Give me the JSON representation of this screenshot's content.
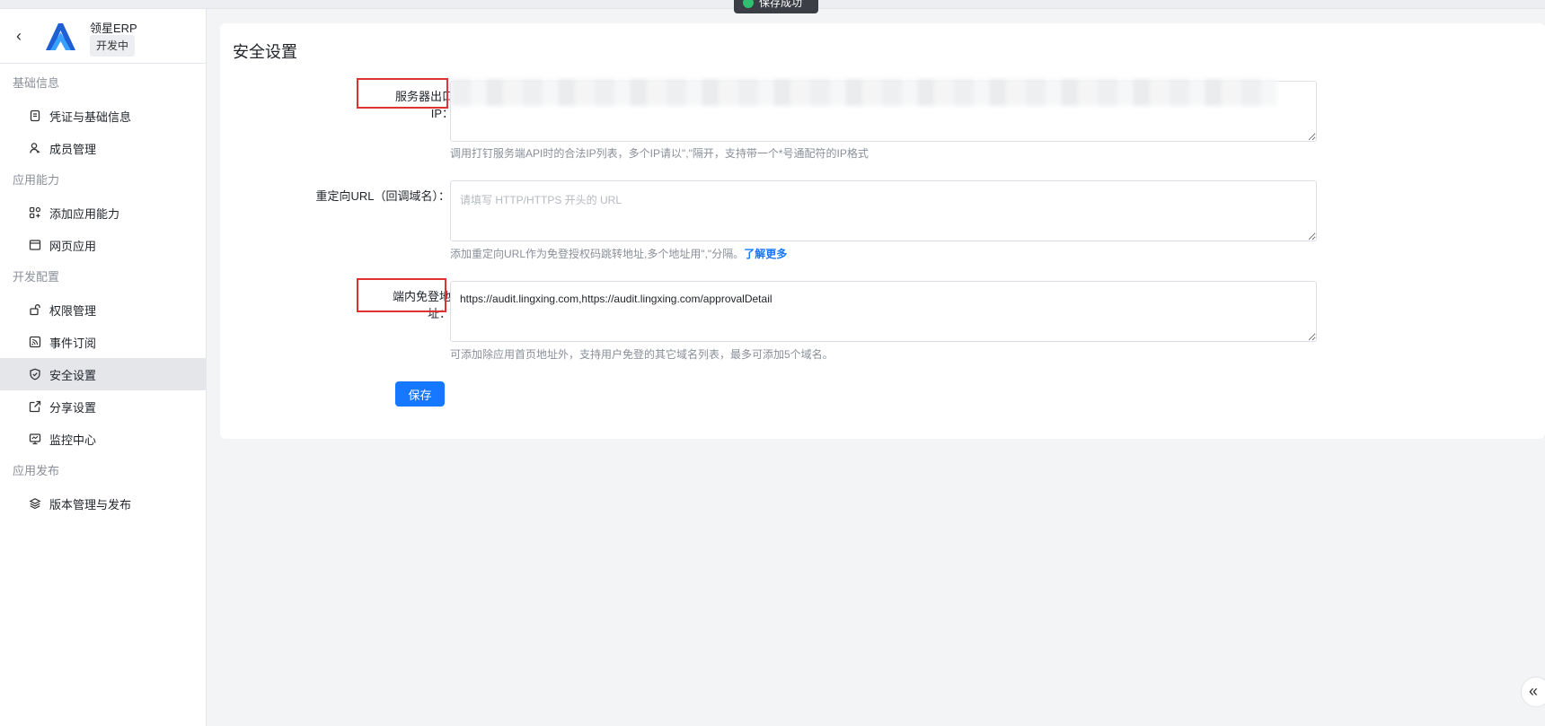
{
  "toast": {
    "text": "保存成功"
  },
  "app": {
    "name": "领星ERP",
    "status": "开发中"
  },
  "sidebar": {
    "groups": [
      {
        "title": "基础信息",
        "items": [
          {
            "label": "凭证与基础信息"
          },
          {
            "label": "成员管理"
          }
        ]
      },
      {
        "title": "应用能力",
        "items": [
          {
            "label": "添加应用能力"
          },
          {
            "label": "网页应用"
          }
        ]
      },
      {
        "title": "开发配置",
        "items": [
          {
            "label": "权限管理"
          },
          {
            "label": "事件订阅"
          },
          {
            "label": "安全设置"
          },
          {
            "label": "分享设置"
          },
          {
            "label": "监控中心"
          }
        ]
      },
      {
        "title": "应用发布",
        "items": [
          {
            "label": "版本管理与发布"
          }
        ]
      }
    ],
    "active_item": "安全设置"
  },
  "page": {
    "title": "安全设置",
    "ip_field": {
      "label": "服务器出口IP：",
      "value": "",
      "help": "调用打钉服务端API时的合法IP列表，多个IP请以\",\"隔开，支持带一个*号通配符的IP格式"
    },
    "redirect_field": {
      "label": "重定向URL（回调域名）：",
      "placeholder": "请填写 HTTP/HTTPS 开头的 URL",
      "help": "添加重定向URL作为免登授权码跳转地址,多个地址用\",\"分隔。",
      "help_link": "了解更多"
    },
    "login_field": {
      "label": "端内免登地址：",
      "value": "https://audit.lingxing.com,https://audit.lingxing.com/approvalDetail",
      "help": "可添加除应用首页地址外，支持用户免登的其它域名列表，最多可添加5个域名。"
    },
    "save_label": "保存"
  },
  "collapse_icon": "«",
  "colors": {
    "primary": "#1677ff",
    "highlight": "#e03131",
    "active_nav": "#e4e6ea"
  }
}
